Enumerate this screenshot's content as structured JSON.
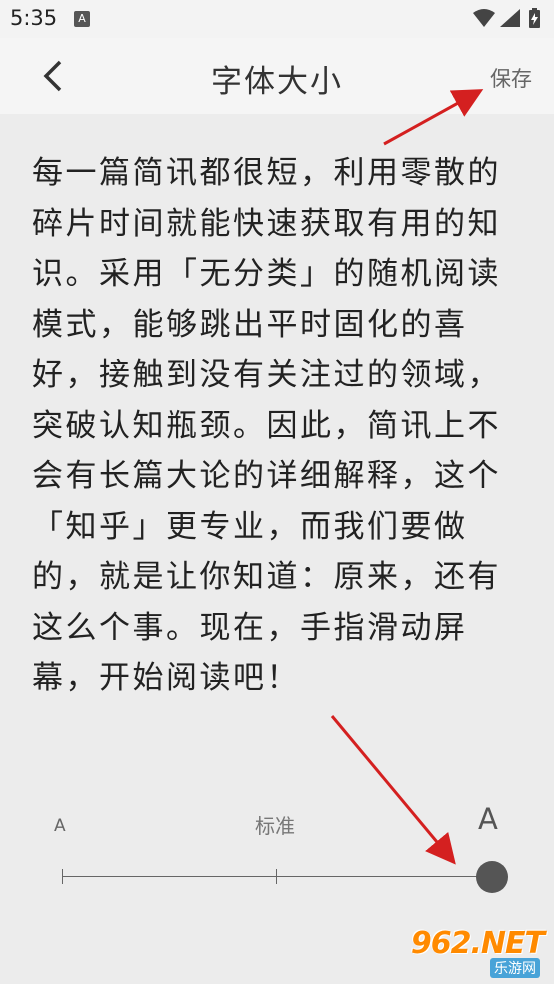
{
  "status_bar": {
    "time": "5:35",
    "a_icon": "A",
    "icons": [
      "wifi-icon",
      "signal-icon",
      "battery-charging-icon"
    ]
  },
  "app_bar": {
    "title": "字体大小",
    "save_label": "保存",
    "back_icon": "chevron-left-icon"
  },
  "preview": {
    "text": "每一篇简讯都很短，利用零散的碎片时间就能快速获取有用的知识。采用「无分类」的随机阅读模式，能够跳出平时固化的喜好，接触到没有关注过的领域，突破认知瓶颈。因此，简讯上不会有长篇大论的详细解释，这个「知乎」更专业，而我们要做的，就是让你知道：原来，还有这么个事。现在，手指滑动屏幕，开始阅读吧！"
  },
  "font_slider": {
    "small_label": "A",
    "standard_label": "标准",
    "large_label": "A",
    "selected_level": "large"
  },
  "watermark": {
    "main": "962.NET",
    "sub": "乐游网"
  },
  "colors": {
    "background": "#ececec",
    "annotation_arrow": "#d42020",
    "watermark_orange": "#ff8a00"
  }
}
